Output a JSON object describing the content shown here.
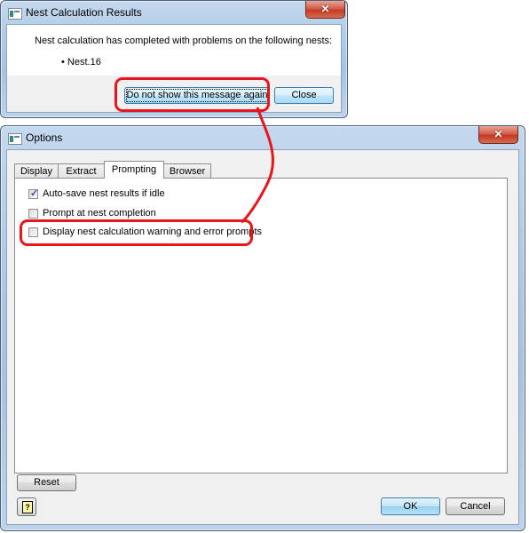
{
  "message_dialog": {
    "title": "Nest Calculation Results",
    "close_glyph": "✕",
    "message": "Nest calculation has completed with problems on the following nests:",
    "bullet": "•",
    "nests": [
      "Nest.16"
    ],
    "buttons": {
      "dont_show": "Do not show this message again",
      "close": "Close"
    }
  },
  "options_dialog": {
    "title": "Options",
    "close_glyph": "✕",
    "tabs": [
      {
        "label": "Display",
        "active": false
      },
      {
        "label": "Extract",
        "active": false
      },
      {
        "label": "Prompting",
        "active": true
      },
      {
        "label": "Browser",
        "active": false
      }
    ],
    "checkboxes": [
      {
        "label": "Auto-save nest results if idle",
        "checked": true
      },
      {
        "label": "Prompt at nest completion",
        "checked": false
      },
      {
        "label": "Display nest calculation warning and error prompts",
        "checked": false
      }
    ],
    "buttons": {
      "reset": "Reset",
      "help_glyph": "?",
      "ok": "OK",
      "cancel": "Cancel"
    }
  },
  "annotation": {
    "color": "#e8151c"
  }
}
